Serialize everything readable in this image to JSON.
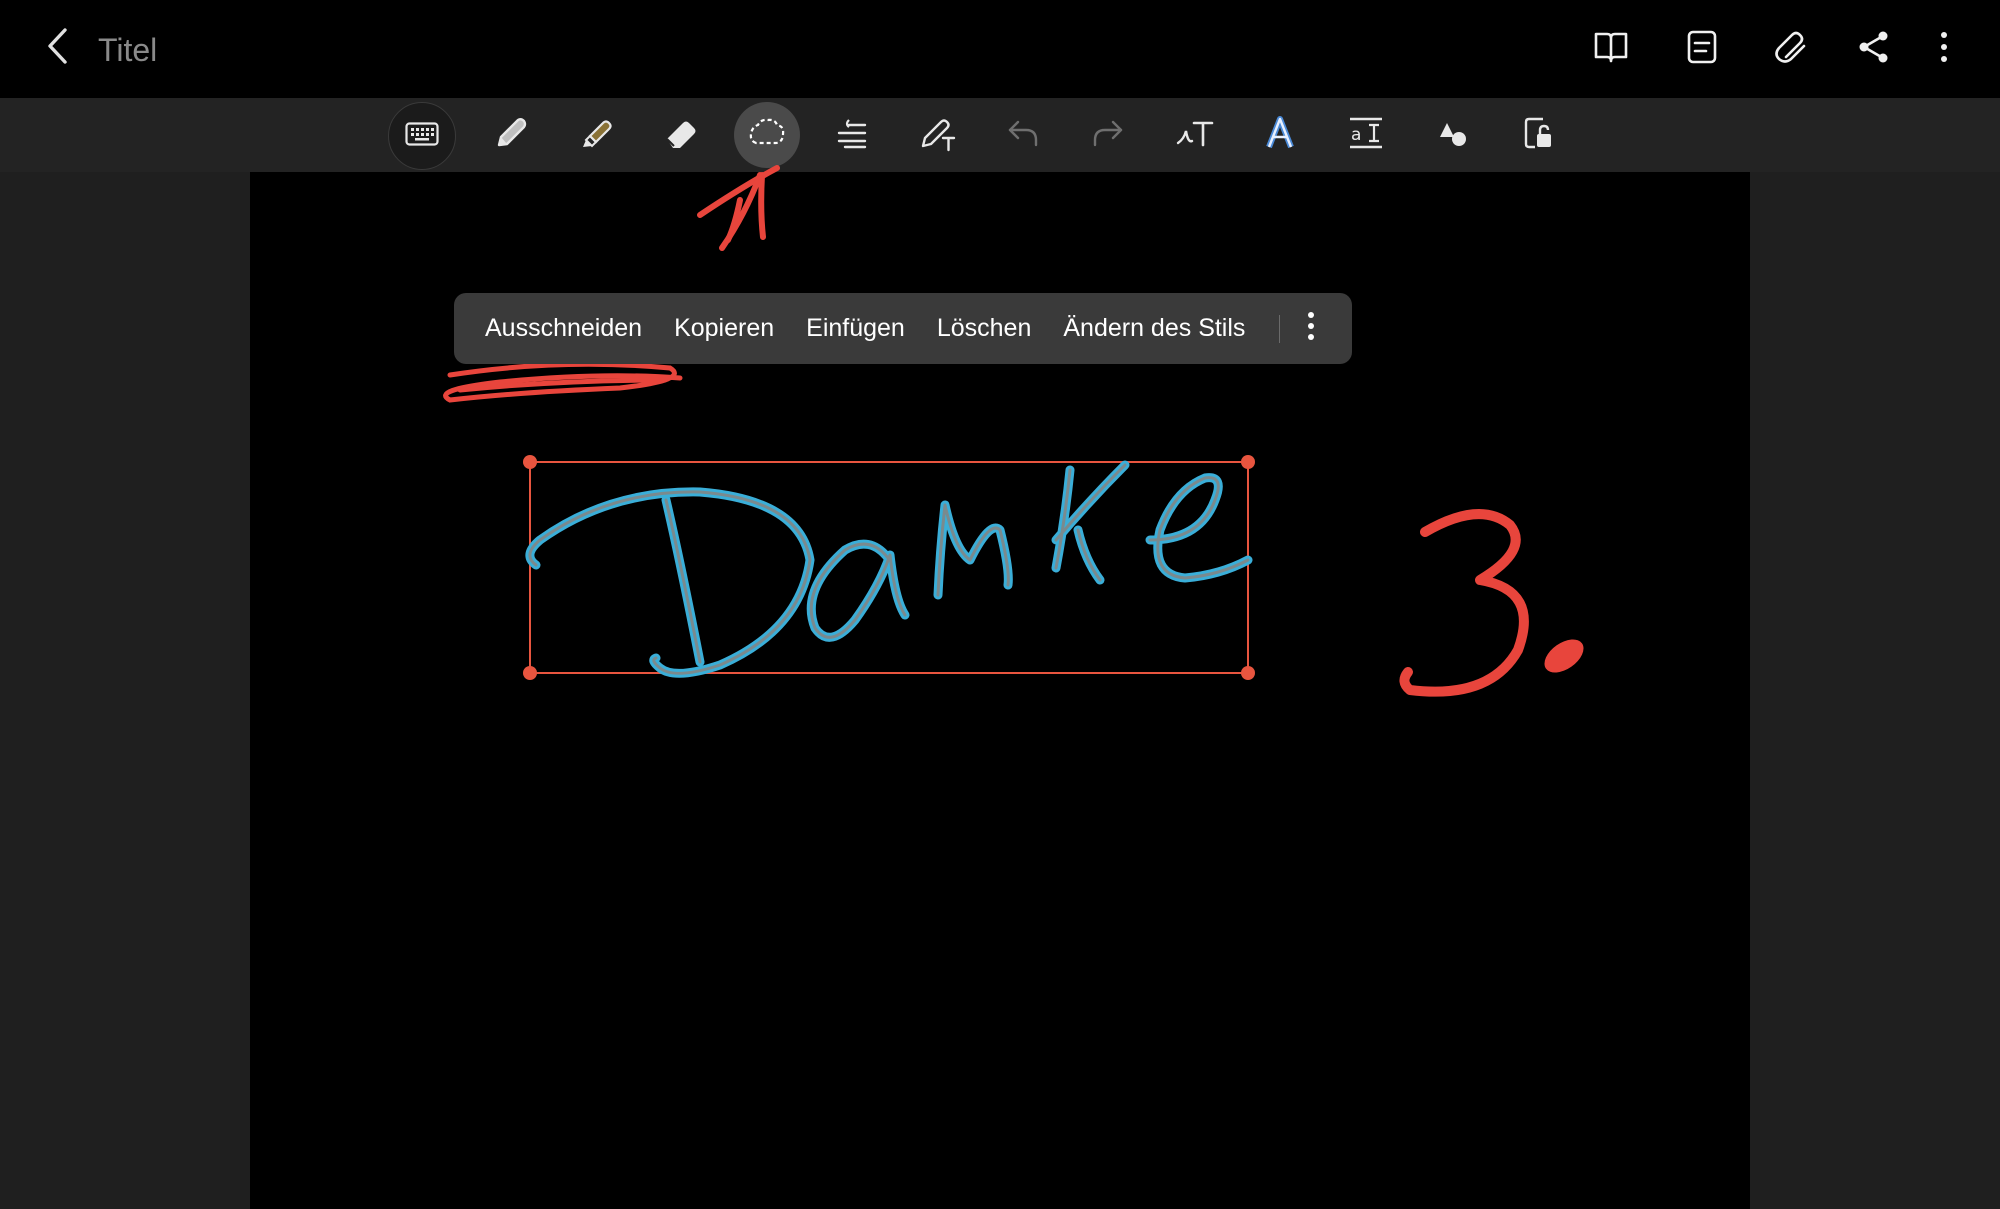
{
  "header": {
    "title": "Titel",
    "actions": [
      "book-icon",
      "document-icon",
      "paperclip-icon",
      "share-icon",
      "more-vertical-icon"
    ]
  },
  "toolbar": {
    "tools": [
      "keyboard-icon",
      "pen-icon",
      "highlighter-icon",
      "eraser-icon",
      "lasso-select-icon",
      "text-align-icon",
      "pen-text-icon",
      "undo-icon",
      "redo-icon",
      "handwriting-to-text-icon",
      "text-style-icon",
      "text-size-icon",
      "shapes-icon",
      "lock-icon"
    ],
    "active_tool": "lasso-select-icon"
  },
  "context_menu": {
    "items": [
      "Ausschneiden",
      "Kopieren",
      "Einfügen",
      "Löschen",
      "Ändern des Stils"
    ]
  },
  "canvas": {
    "handwritten_text": "Danke",
    "annotation_number": "3."
  },
  "colors": {
    "selection": "#e8553f",
    "ink": "#3aaed8",
    "annotation": "#e8453c",
    "active_tool_bg": "#4a4a4a"
  }
}
